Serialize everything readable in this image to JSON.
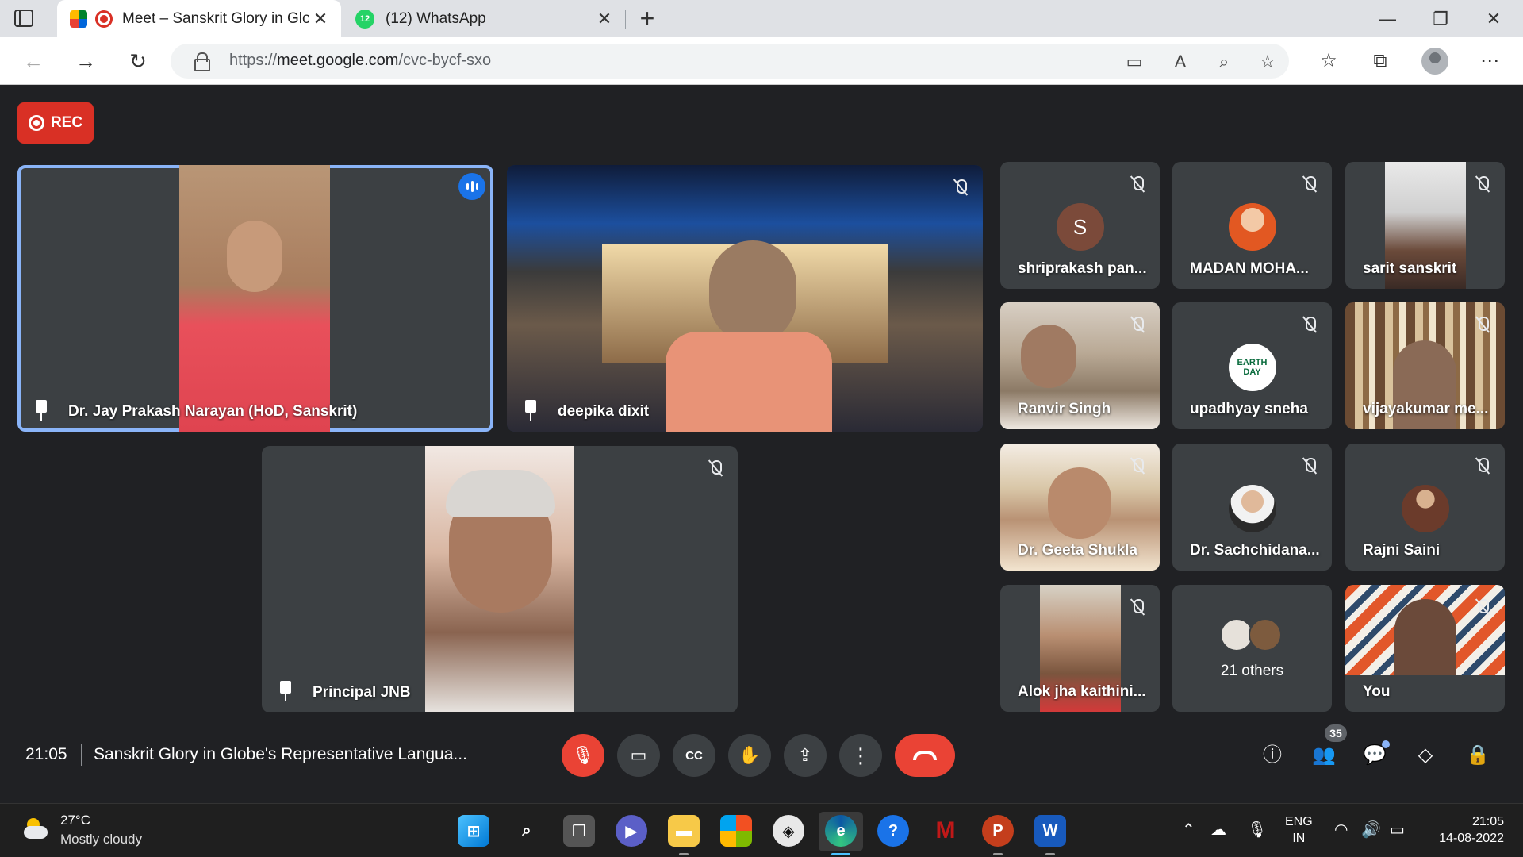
{
  "browser": {
    "tabs": [
      {
        "title": "Meet – Sanskrit Glory in Globe's Representative Languages",
        "active": true
      },
      {
        "title": "(12) WhatsApp",
        "badge": "12",
        "active": false
      }
    ],
    "url_prefix": "https://",
    "url_host": "meet.google.com",
    "url_path": "/cvc-bycf-sxo"
  },
  "meet": {
    "rec_label": "REC",
    "main_tiles": [
      {
        "name": "Dr. Jay Prakash Narayan (HoD, Sanskrit)",
        "pinned": true,
        "speaking": true
      },
      {
        "name": "deepika dixit",
        "pinned": true,
        "muted": true
      },
      {
        "name": "Principal JNB",
        "pinned": true,
        "muted": true
      }
    ],
    "grid_tiles": [
      {
        "name": "shriprakash pan...",
        "avatar_letter": "S",
        "muted": true
      },
      {
        "name": "MADAN MOHA...",
        "muted": true
      },
      {
        "name": "sarit sanskrit",
        "muted": true
      },
      {
        "name": "Ranvir Singh",
        "muted": true
      },
      {
        "name": "upadhyay sneha",
        "avatar_text": "EARTH DAY",
        "muted": true
      },
      {
        "name": "vijayakumar me...",
        "muted": true
      },
      {
        "name": "Dr. Geeta Shukla",
        "muted": true
      },
      {
        "name": "Dr. Sachchidana...",
        "muted": true
      },
      {
        "name": "Rajni Saini",
        "muted": true
      },
      {
        "name": "Alok jha kaithini...",
        "muted": true
      },
      {
        "name": "21 others"
      },
      {
        "name": "You",
        "muted": true
      }
    ],
    "clock": "21:05",
    "meeting_title": "Sanskrit Glory in Globe's Representative Langua...",
    "people_count": "35"
  },
  "taskbar": {
    "temperature": "27°C",
    "condition": "Mostly cloudy",
    "lang_line1": "ENG",
    "lang_line2": "IN",
    "time": "21:05",
    "date": "14-08-2022"
  },
  "colors": {
    "meet_bg": "#202124",
    "tile_bg": "#3c4043",
    "rec_red": "#d93025",
    "speaking_outline": "#8ab4f8",
    "hangup_red": "#ea4335"
  }
}
